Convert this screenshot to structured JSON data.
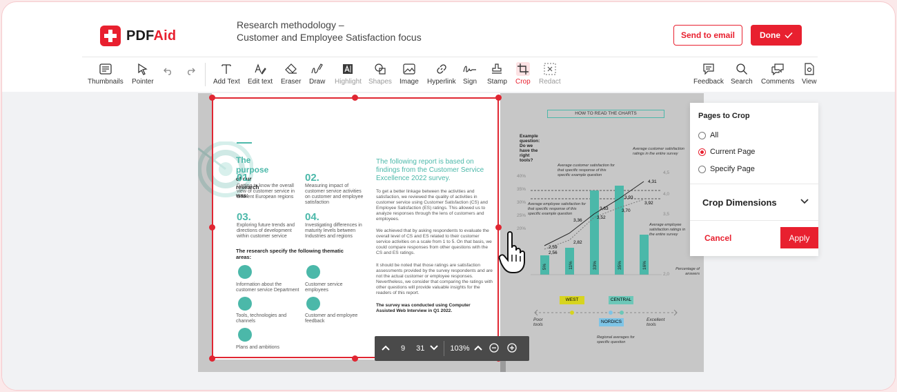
{
  "app": {
    "brand_prefix": "PDF",
    "brand_suffix": "Aid"
  },
  "header": {
    "send_email_label": "Send to email",
    "done_label": "Done"
  },
  "toolbar": {
    "thumbnails": "Thumbnails",
    "pointer": "Pointer",
    "add_text": "Add Text",
    "edit_text": "Edit text",
    "eraser": "Eraser",
    "draw": "Draw",
    "highlight": "Highlight",
    "shapes": "Shapes",
    "image": "Image",
    "hyperlink": "Hyperlink",
    "sign": "Sign",
    "stamp": "Stamp",
    "crop": "Crop",
    "redact": "Redact",
    "feedback": "Feedback",
    "search": "Search",
    "comments": "Comments",
    "view": "View"
  },
  "document": {
    "title_line1": "Research methodology –",
    "title_line2": "Customer and Employee Satisfaction focus",
    "purpose_heading": "The purpose",
    "purpose_rest": "of our research was:",
    "items": [
      {
        "num": "01.",
        "text": "Getting to know the overall view of customer service in different European regions"
      },
      {
        "num": "02.",
        "text": "Measuring impact of customer service activities on customer and employee satisfaction"
      },
      {
        "num": "03.",
        "text": "Exploring future trends and directions of development within customer service"
      },
      {
        "num": "04.",
        "text": "Investigating differences in maturity levels between Industries and regions"
      }
    ],
    "thematic_heading": "The research specify the following thematic areas:",
    "areas": [
      "Information about the customer service Department",
      "Customer service employees",
      "Tools, technologies and channels",
      "Customer and employee feedback",
      "Plans and ambitions"
    ],
    "report_intro": "The following report is based on findings from the Customer Service Excellence 2022 survey.",
    "para1": "To get a better linkage between the activities and satisfaction, we reviewed the quality of activities in customer service using Customer Satisfaction (CS) and Employee Satisfaction (ES) ratings. This allowed us to analyze responses through the lens of customers and employees.",
    "para2": "We achieved that by asking respondents to evaluate the overall level of CS and ES related to their customer service activities on a scale from 1 to 5. On that basis, we could compare responses from other questions with the CS and ES ratings.",
    "para3": "It should be noted that those ratings are satisfaction assessments provided by the survey respondents and are not the actual customer or employee responses. Nevertheless, we consider that comparing the ratings with other questions will provide valuable insights for the readers of this report.",
    "para4": "The survey was conducted using Computer Assisted Web Interview in Q1 2022."
  },
  "right_page": {
    "banner": "HOW TO READ THE CHARTS",
    "question": "Example question: Do we have the right tools?",
    "note_customer": "Average customer satisfaction for that specific response of this specific example question",
    "note_customer_survey": "Average customer satisfaction ratings in the entire survey",
    "note_employee": "Average employee satisfaction for that specific response of this specific example question",
    "note_employee_survey": "Average employee satisfaction ratings in the entire survey",
    "note_percentage": "Percentage of answers",
    "left_ticks": [
      "40%",
      "35%",
      "30%",
      "25%",
      "20%"
    ],
    "right_ticks": [
      "4,5",
      "4,0",
      "3,5",
      "2,0"
    ],
    "bar_labels": [
      "5%",
      "11%",
      "33%",
      "35%",
      "16%"
    ],
    "point_labels": [
      "2,59",
      "2,56",
      "3,36",
      "2,82",
      "3,63",
      "3,52",
      "3,93",
      "3,70",
      "4,31",
      "3,92"
    ],
    "regions": [
      "WEST",
      "CENTRAL",
      "NORDICS"
    ],
    "scale_left": "Poor tools",
    "scale_right": "Excellent tools",
    "regional_note": "Regional averages for specific question"
  },
  "pager": {
    "current_page": "9",
    "total_pages": "31",
    "zoom": "103%"
  },
  "crop_panel": {
    "title": "Pages to Crop",
    "options": [
      "All",
      "Current Page",
      "Specify Page"
    ],
    "selected": "Current Page",
    "dimensions_label": "Crop Dimensions",
    "cancel_label": "Cancel",
    "apply_label": "Apply"
  },
  "colors": {
    "brand": "#e8202f",
    "teal": "#4bb8a9",
    "crop_border": "#e02632"
  }
}
